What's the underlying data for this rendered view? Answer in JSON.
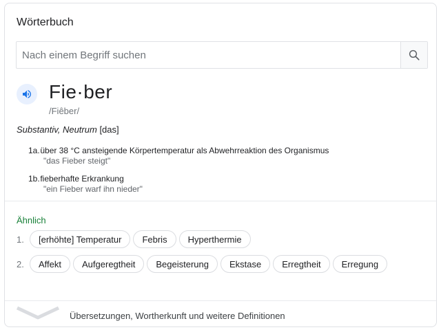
{
  "panel": {
    "title": "Wörterbuch"
  },
  "search": {
    "placeholder": "Nach einem Begriff suchen",
    "value": ""
  },
  "entry": {
    "word": "Fie·ber",
    "phonetic": "/Fiêber/",
    "pos_type": "Substantiv, Neutrum",
    "article": "[das]",
    "senses": [
      {
        "num": "1a.",
        "text": "über 38 °C ansteigende Körpertemperatur als Abwehrreaktion des Organismus",
        "example": "\"das Fieber steigt\""
      },
      {
        "num": "1b.",
        "text": "fieberhafte Erkrankung",
        "example": "\"ein Fieber warf ihn nieder\""
      }
    ]
  },
  "similar": {
    "heading": "Ähnlich",
    "groups": [
      {
        "num": "1.",
        "items": [
          "[erhöhte] Temperatur",
          "Febris",
          "Hyperthermie"
        ]
      },
      {
        "num": "2.",
        "items": [
          "Affekt",
          "Aufgeregtheit",
          "Begeisterung",
          "Ekstase",
          "Erregtheit",
          "Erregung"
        ]
      }
    ]
  },
  "footer": {
    "text": "Übersetzungen, Wortherkunft und weitere Definitionen"
  },
  "colors": {
    "accent": "#1a73e8",
    "similar_heading": "#188038",
    "border": "#dfe1e5"
  },
  "icons": {
    "search": "search-icon",
    "speaker": "speaker-icon",
    "expand": "chevron-down-icon"
  }
}
